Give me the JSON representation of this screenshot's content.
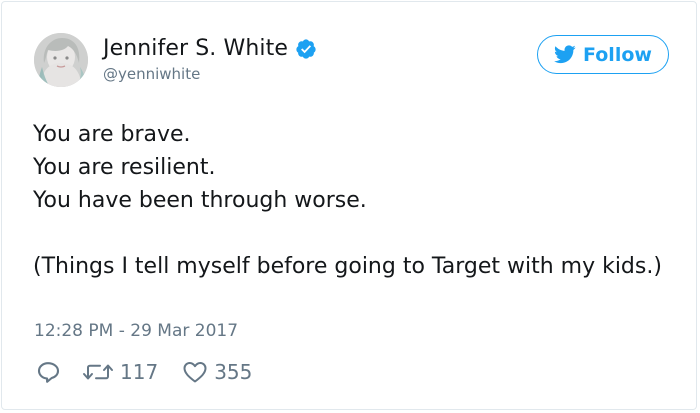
{
  "user": {
    "display_name": "Jennifer S. White",
    "handle": "@yenniwhite",
    "verified": true
  },
  "follow_button": {
    "label": "Follow"
  },
  "tweet": {
    "lines": [
      "You are brave.",
      "You are resilient.",
      "You have been through worse.",
      "(Things I tell myself before going to Target with my kids.)"
    ],
    "timestamp": "12:28 PM - 29 Mar 2017"
  },
  "actions": {
    "retweet_count": "117",
    "like_count": "355"
  },
  "colors": {
    "brand_blue": "#1da1f2",
    "muted_text": "#657786",
    "primary_text": "#14171a",
    "border": "#e1e8ed"
  },
  "icons": {
    "verified": "verified-badge-icon",
    "follow": "twitter-bird-icon",
    "reply": "reply-bubble-icon",
    "retweet": "retweet-arrows-icon",
    "like": "heart-icon"
  }
}
